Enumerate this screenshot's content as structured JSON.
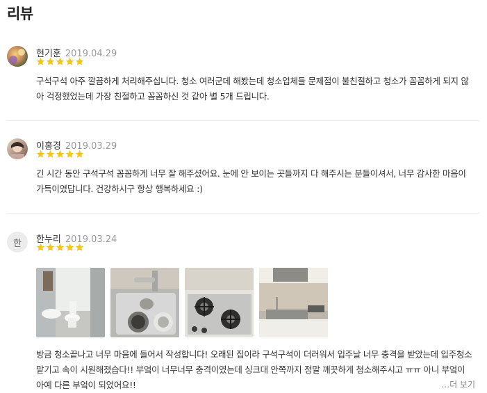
{
  "section_title": "리뷰",
  "colors": {
    "star": "#f5c518",
    "divider": "#ececec",
    "date": "#999999"
  },
  "reviews": [
    {
      "name": "현기훈",
      "date": "2019.04.29",
      "rating": 5,
      "avatar": "photo",
      "text": "구석구석 아주 깔끔하게 처리해주십니다. 청소 여러군데 해봤는데 청소업체들 문제점이 불친절하고 청소가 꼼꼼하게 되지 않아 걱정했었는데 가장 친절하고 꼼꼼하신 것 같아 별 5개 드립니다."
    },
    {
      "name": "이홍경",
      "date": "2019.03.29",
      "rating": 5,
      "avatar": "photo",
      "text": "긴 시간 동안 구석구석 꼼꼼하게 너무 잘 해주셨어요. 눈에 안 보이는 곳들까지 다 해주시는 분들이셔서, 너무 감사한 마음이 가득이였답니다. 건강하시구 항상 행복하세요 :)"
    },
    {
      "name": "한누리",
      "date": "2019.03.24",
      "rating": 5,
      "avatar_initial": "한",
      "photos": [
        "bathroom-photo",
        "sink-drain-photo",
        "gas-stove-photo",
        "kitchen-counter-photo"
      ],
      "text": "방금 청소끝나고 너무 마음에 들어서 작성합니다! 오래된 집이라 구석구석이 더러워서 입주날 너무 충격을 받았는데 입주청소 맡기고 속이 시원해졌습다!! 부엌이 너무너무 충격이였는데 싱크대 안쪽까지 정말 깨끗하게 청소해주시고 ㅠㅠ 아니 부엌이 아예 다른 부엌이 되었어요!!",
      "more_label": "…더 보기"
    }
  ]
}
